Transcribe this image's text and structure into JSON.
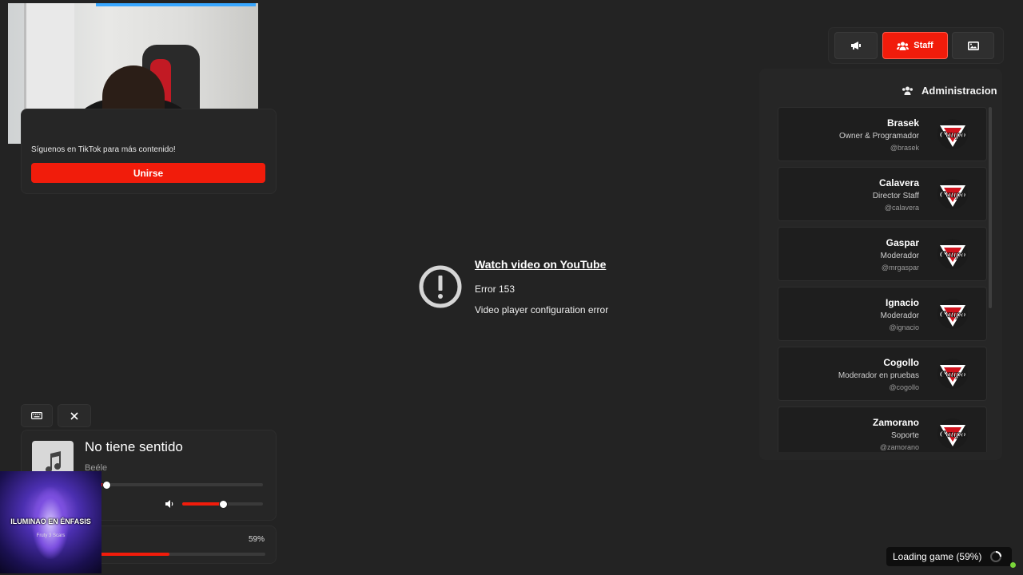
{
  "tiktok": {
    "text": "Síguenos en TikTok para más contenido!",
    "join_label": "Unirse"
  },
  "topbar": {
    "staff_label": "Staff",
    "active": "staff"
  },
  "admin": {
    "title": "Administracion",
    "staff": [
      {
        "name": "Brasek",
        "role": "Owner & Programador",
        "handle": "@brasek"
      },
      {
        "name": "Calavera",
        "role": "Director Staff",
        "handle": "@calavera"
      },
      {
        "name": "Gaspar",
        "role": "Moderador",
        "handle": "@mrgaspar"
      },
      {
        "name": "Ignacio",
        "role": "Moderador",
        "handle": "@ignacio"
      },
      {
        "name": "Cogollo",
        "role": "Moderador en pruebas",
        "handle": "@cogollo"
      },
      {
        "name": "Zamorano",
        "role": "Soporte",
        "handle": "@zamorano"
      }
    ],
    "logo_text": "Caupo"
  },
  "video_error": {
    "link": "Watch video on YouTube",
    "code": "Error 153",
    "message": "Video player configuration error"
  },
  "music": {
    "title": "No tiene sentido",
    "artist": "Beéle",
    "progress": 0.12,
    "volume": 0.5
  },
  "loading": {
    "percent_label": "59%",
    "progress": 0.59
  },
  "overlay": {
    "caption": "ILUMINAO EN ÉNFASIS",
    "small": "Fruty 3 Scars"
  },
  "toast": {
    "text": "Loading game (59%)"
  },
  "colors": {
    "accent": "#f11c0b",
    "panel": "#262626",
    "background": "#232323"
  },
  "icons": [
    "megaphone-icon",
    "users-icon",
    "image-icon",
    "keyboard-icon",
    "close-icon",
    "music-note-icon",
    "volume-icon",
    "alert-circle-icon",
    "spinner-icon"
  ]
}
